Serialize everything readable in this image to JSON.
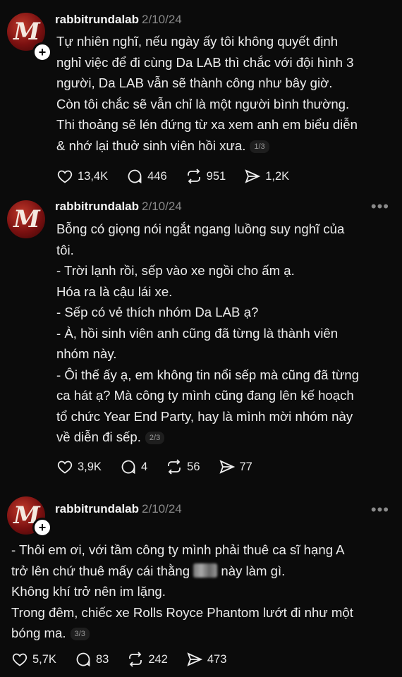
{
  "posts": [
    {
      "username": "rabbitrundalab",
      "date": "2/10/24",
      "avatar_letter": "M",
      "lines": [
        "Tự nhiên nghĩ, nếu ngày ấy tôi không quyết định",
        "nghỉ việc để đi cùng Da LAB thì chắc với đội hình 3",
        "người, Da LAB vẫn sẽ thành công như bây giờ.",
        "Còn tôi chắc sẽ vẫn chỉ là một người bình thường.",
        "Thi thoảng sẽ lén đứng từ xa xem anh em biểu diễn",
        "& nhớ lại thuở sinh viên hồi xưa."
      ],
      "page": "1/3",
      "likes": "13,4K",
      "comments": "446",
      "reposts": "951",
      "shares": "1,2K"
    },
    {
      "username": "rabbitrundalab",
      "date": "2/10/24",
      "avatar_letter": "M",
      "more": "•••",
      "lines": [
        "Bỗng có giọng nói ngắt ngang luồng suy nghĩ của",
        "tôi.",
        "- Trời lạnh rồi, sếp vào xe ngồi cho ấm ạ.",
        "Hóa ra là cậu lái xe.",
        "- Sếp có vẻ thích nhóm Da LAB ạ?",
        "- À, hồi sinh viên anh cũng đã từng là thành viên",
        "nhóm này.",
        "- Ôi thế ấy ạ, em không tin nổi sếp mà cũng đã từng",
        "ca hát ạ? Mà công ty mình cũng đang lên kế hoạch",
        "tổ chức Year End Party, hay là mình mời nhóm này",
        "về diễn đi sếp."
      ],
      "page": "2/3",
      "likes": "3,9K",
      "comments": "4",
      "reposts": "56",
      "shares": "77"
    },
    {
      "username": "rabbitrundalab",
      "date": "2/10/24",
      "avatar_letter": "M",
      "more": "•••",
      "lines": [
        "- Thôi em ơi, với tầm công ty mình phải thuê ca sĩ hạng A",
        "trở lên chứ thuê mấy cái thằng",
        "này làm gì.",
        "Không khí trở nên im lặng.",
        "Trong đêm, chiếc xe Rolls Royce Phantom lướt đi như một",
        "bóng ma."
      ],
      "page": "3/3",
      "likes": "5,7K",
      "comments": "83",
      "reposts": "242",
      "shares": "473"
    }
  ],
  "colors": {
    "background": "#0b0b0b",
    "text": "#f2f2f2",
    "muted": "#8a8a8a",
    "avatar": "#b3261e"
  },
  "icons": [
    "heart-icon",
    "comment-icon",
    "repost-icon",
    "share-icon",
    "plus-icon",
    "more-icon"
  ]
}
